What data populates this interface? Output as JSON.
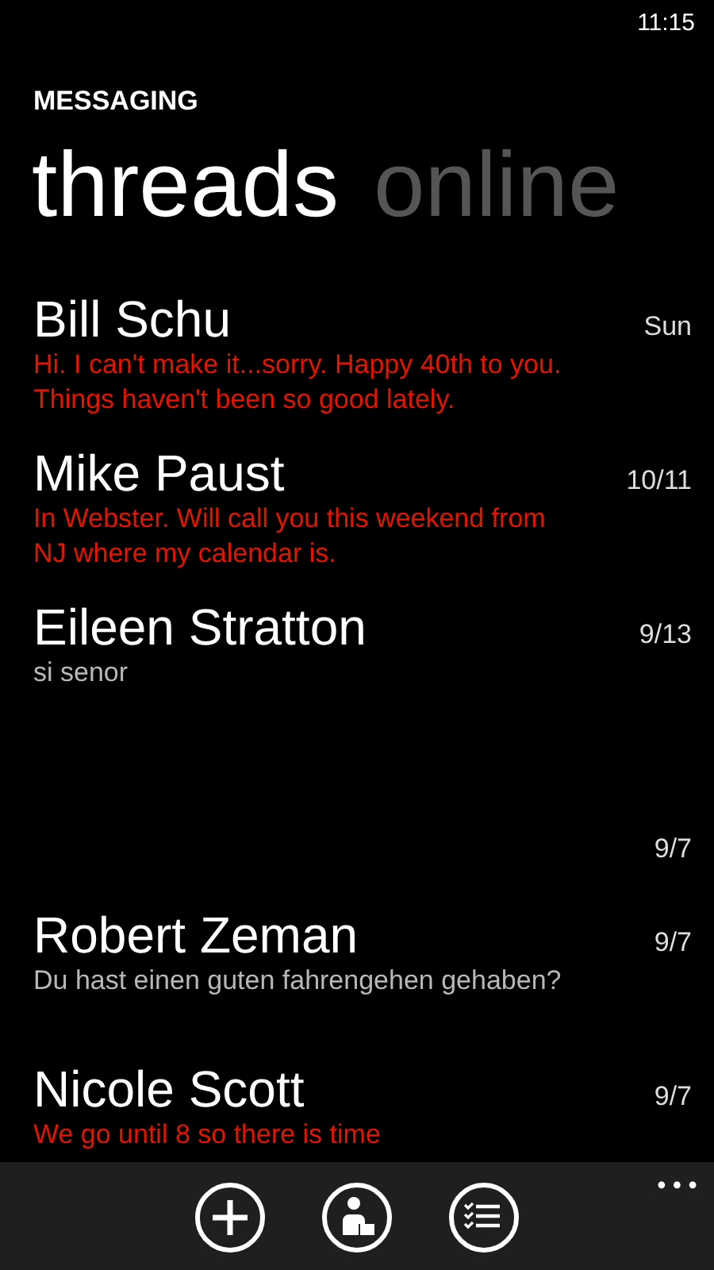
{
  "status_bar": {
    "time": "11:15"
  },
  "app_title": "MESSAGING",
  "pivots": [
    {
      "label": "threads",
      "selected": true
    },
    {
      "label": "online",
      "selected": false
    }
  ],
  "threads": [
    {
      "name": "Bill Schu",
      "date": "Sun",
      "preview": "Hi. I can't make it...sorry. Happy 40th to you. Things haven't been so good lately.",
      "unread": true
    },
    {
      "name": "Mike Paust",
      "date": "10/11",
      "preview": "In Webster.  Will call you this weekend from NJ where my calendar is.",
      "unread": true
    },
    {
      "name": "Eileen Stratton",
      "date": "9/13",
      "preview": "si senor",
      "unread": false
    },
    {
      "date": "9/7"
    },
    {
      "name": "Robert Zeman",
      "date": "9/7",
      "preview": "Du hast einen guten fahrengehen gehaben?",
      "unread": false
    },
    {
      "name": "Nicole Scott",
      "date": "9/7",
      "preview": "We go until 8 so there is time",
      "unread": true
    }
  ],
  "app_bar": {
    "buttons": [
      {
        "kind": "new"
      },
      {
        "kind": "contact"
      },
      {
        "kind": "select"
      }
    ],
    "more": "•••"
  }
}
